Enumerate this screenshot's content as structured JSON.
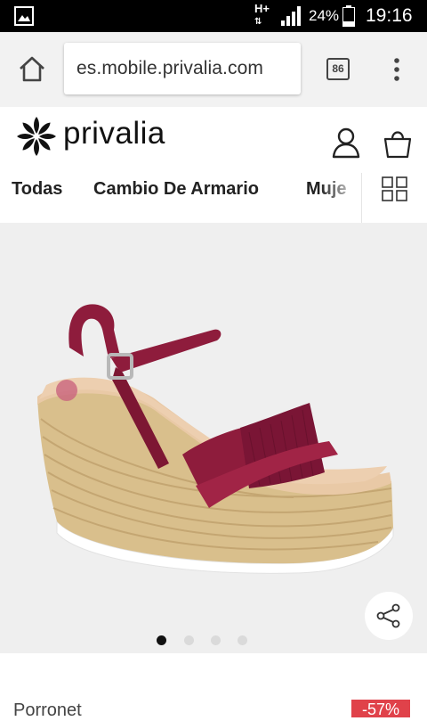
{
  "status_bar": {
    "network_type": "H+",
    "battery_percent": "24%",
    "time": "19:16"
  },
  "browser": {
    "url": "es.mobile.privalia.com",
    "tab_count": "86"
  },
  "site": {
    "logo_text": "privalia"
  },
  "category_nav": {
    "items": [
      "Todas",
      "Cambio De Armario",
      "Muje"
    ]
  },
  "product": {
    "image_dots": {
      "count": 4,
      "active_index": 0
    },
    "brand": "Porronet",
    "discount": "-57%"
  },
  "colors": {
    "accent": "#e0424a",
    "dot_active": "#111111",
    "dot_inactive": "#d6d6d6",
    "shoe_strap": "#8e1c3c"
  }
}
